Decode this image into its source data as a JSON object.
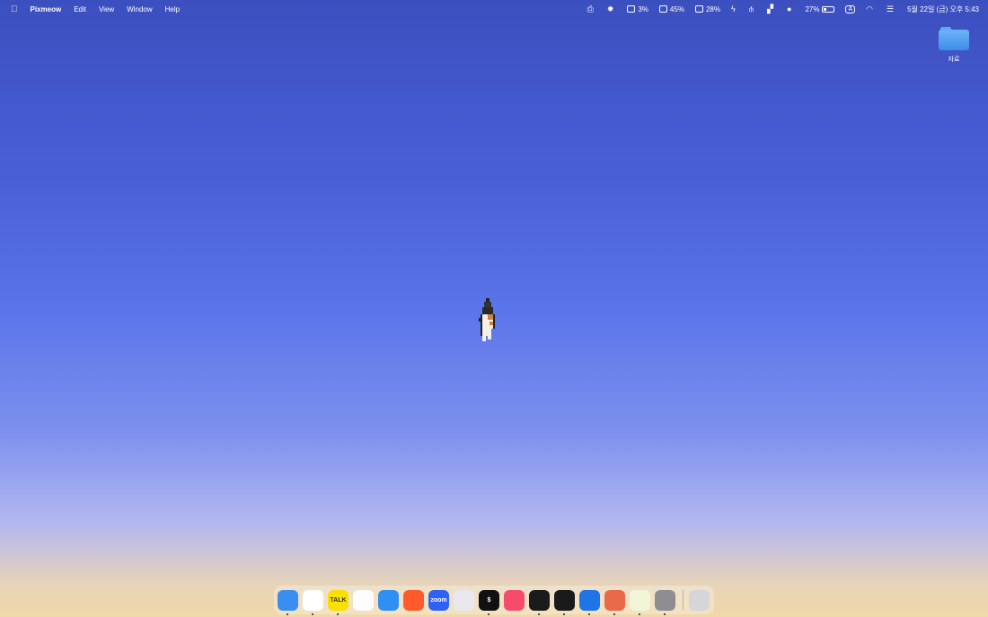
{
  "menubar": {
    "apple_icon": "apple-icon",
    "app_name": "Pixmeow",
    "menus": [
      "Edit",
      "View",
      "Window",
      "Help"
    ],
    "status": [
      {
        "icon": "printer-icon",
        "text": ""
      },
      {
        "icon": "sun-icon",
        "text": ""
      },
      {
        "icon": "cpu-icon",
        "text": "3%"
      },
      {
        "icon": "memory-icon",
        "text": "45%"
      },
      {
        "icon": "storage-icon",
        "text": "28%"
      },
      {
        "icon": "bolt-icon",
        "text": ""
      },
      {
        "icon": "network-icon",
        "text": ""
      },
      {
        "icon": "layout-icon",
        "text": ""
      },
      {
        "icon": "chat-icon",
        "text": ""
      },
      {
        "icon": "battery-icon",
        "text": "27%"
      },
      {
        "icon": "input-source-icon",
        "text": "A"
      },
      {
        "icon": "wifi-icon",
        "text": ""
      },
      {
        "icon": "control-center-icon",
        "text": ""
      }
    ],
    "clock": "5월 22일 (금) 오후 5:43"
  },
  "desktop": {
    "folder_label": "자료",
    "pet_icon": "pixel-cat-icon"
  },
  "dock": {
    "items": [
      {
        "name": "finder",
        "color": "#3a8ef0",
        "glyph": "",
        "running": true
      },
      {
        "name": "chrome",
        "color": "#ffffff",
        "glyph": "",
        "running": true
      },
      {
        "name": "kakaotalk",
        "color": "#f9e000",
        "glyph": "TALK",
        "running": true
      },
      {
        "name": "photos",
        "color": "#fdfdfd",
        "glyph": "",
        "running": false
      },
      {
        "name": "mail",
        "color": "#2f8ff2",
        "glyph": "",
        "running": false
      },
      {
        "name": "reddit",
        "color": "#ff5a2c",
        "glyph": "",
        "running": false
      },
      {
        "name": "zoom",
        "color": "#2d62f2",
        "glyph": "zoom",
        "running": false
      },
      {
        "name": "perplexity",
        "color": "#e8e8ee",
        "glyph": "",
        "running": false
      },
      {
        "name": "terminal",
        "color": "#111111",
        "glyph": "$",
        "running": true
      },
      {
        "name": "music",
        "color": "#f54c6c",
        "glyph": "",
        "running": false
      },
      {
        "name": "activity",
        "color": "#1b1b1b",
        "glyph": "",
        "running": true
      },
      {
        "name": "github",
        "color": "#1a1a1a",
        "glyph": "",
        "running": true
      },
      {
        "name": "xcode",
        "color": "#1f74e6",
        "glyph": "",
        "running": true
      },
      {
        "name": "claude",
        "color": "#e86a48",
        "glyph": "",
        "running": true
      },
      {
        "name": "pixmeow",
        "color": "#f2f5d8",
        "glyph": "",
        "running": true
      },
      {
        "name": "system-settings",
        "color": "#8d8d92",
        "glyph": "",
        "running": true
      }
    ],
    "trash": {
      "name": "trash",
      "color": "#d4d6da"
    }
  }
}
